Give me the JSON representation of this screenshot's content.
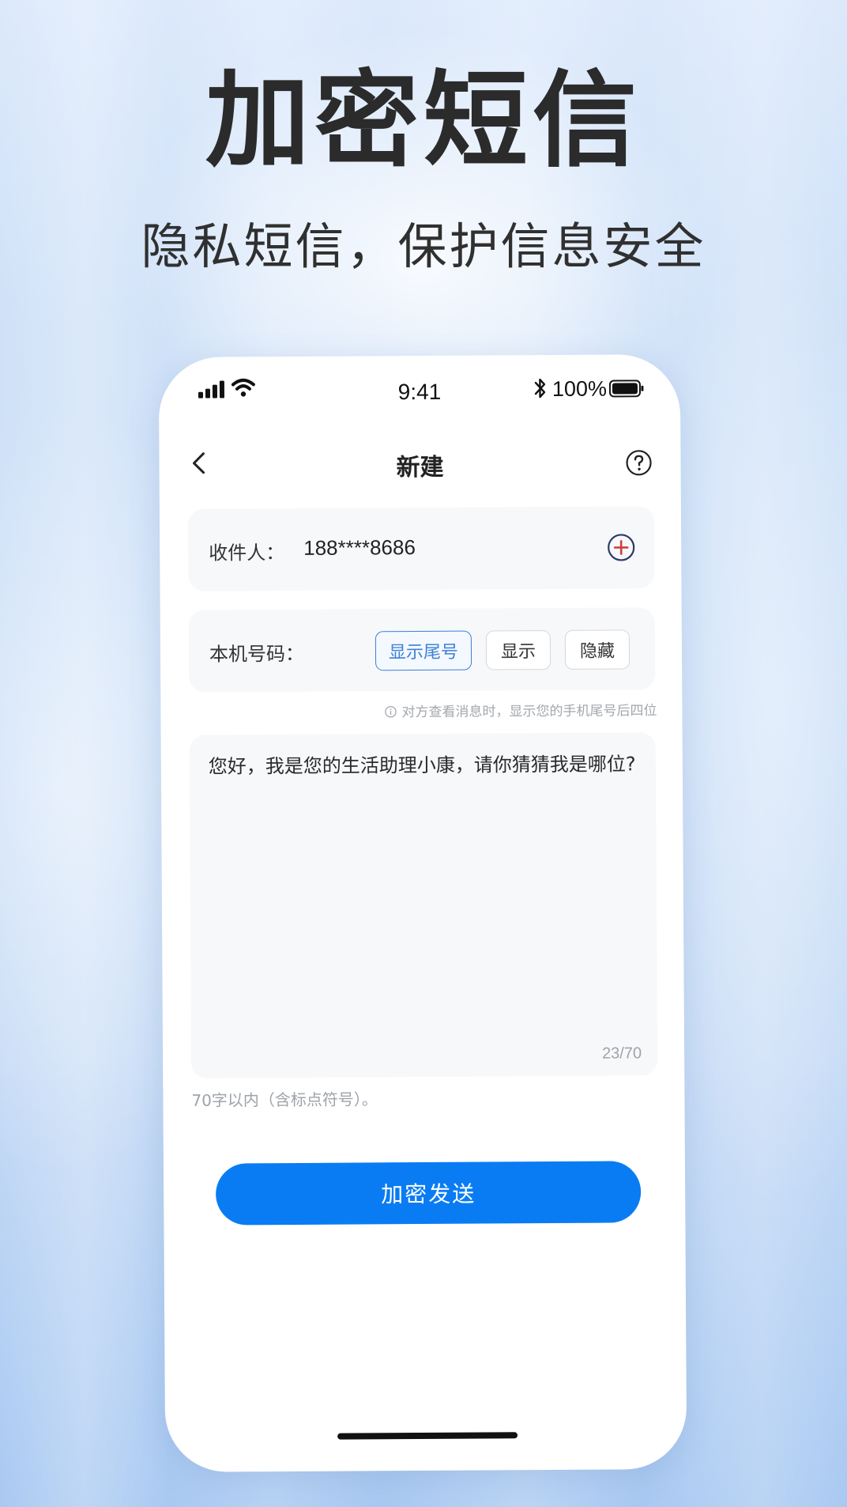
{
  "promo": {
    "headline": "加密短信",
    "subhead": "隐私短信，保护信息安全"
  },
  "status_bar": {
    "time": "9:41",
    "battery_percent": "100%"
  },
  "nav": {
    "title": "新建"
  },
  "recipient": {
    "label": "收件人：",
    "value": "188****8686"
  },
  "own_number": {
    "label": "本机号码：",
    "options": [
      "显示尾号",
      "显示",
      "隐藏"
    ],
    "selected": "显示尾号",
    "hint": "对方查看消息时，显示您的手机尾号后四位"
  },
  "message": {
    "text": "您好，我是您的生活助理小康，请你猜猜我是哪位?",
    "counter": "23/70",
    "limit_note": "70字以内（含标点符号）。"
  },
  "actions": {
    "send_label": "加密发送"
  },
  "colors": {
    "accent": "#0a7cf3",
    "selected_border": "#3d7fd6",
    "add_icon": "#c0392b"
  }
}
